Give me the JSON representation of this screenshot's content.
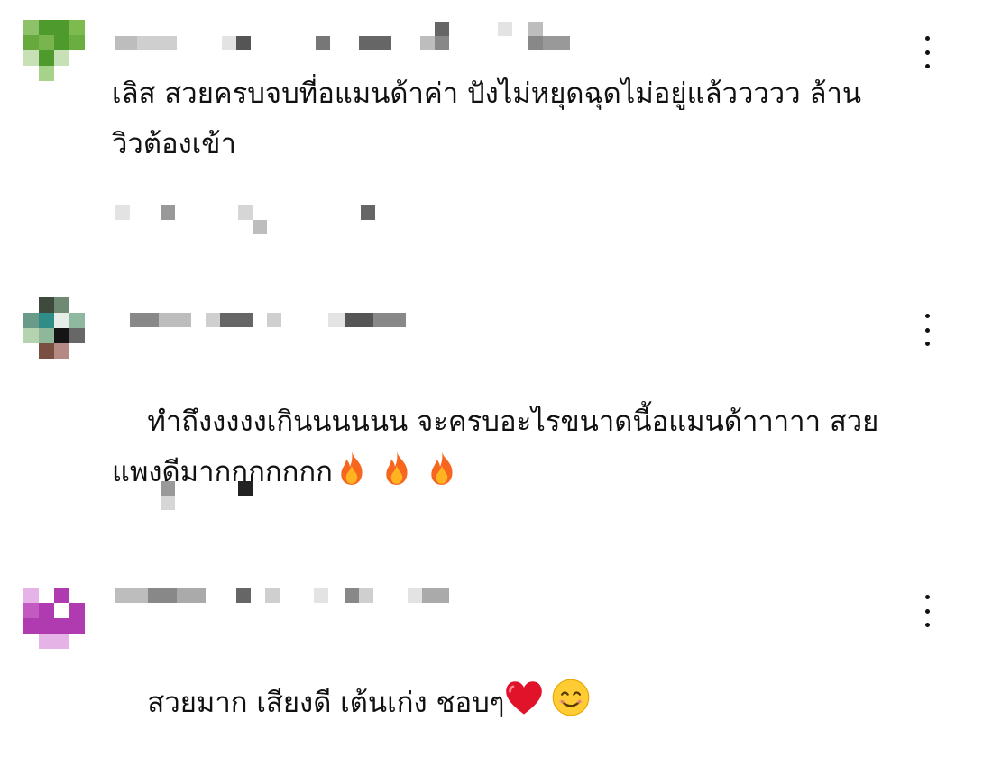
{
  "comments": [
    {
      "text": "เลิส สวยครบจบที่อแมนด้าค่า ปังไม่หยุดฉุดไม่อยู่แล้ววววว ล้าน\nวิวต้องเข้า",
      "avatar_colors": [
        "#8dc26a",
        "#4f9a2c",
        "#4f9a2c",
        "#7dbb4e",
        "#67a93d",
        "#79b54f",
        "#4f9a2c",
        "#6aad40",
        "#c7e0b6",
        "#4f9a2c",
        "#c7e0b6",
        "#ffffff",
        "#ffffff",
        "#a7d28a",
        "#ffffff",
        "#ffffff"
      ],
      "more_icon": "more-vert-icon"
    },
    {
      "text": "ทำถึงงงงงเกินนนนนน จะครบอะไรขนาดนี้อแมนด้าาาาา สวย\nแพงดีมากกกกกกก",
      "avatar_colors": [
        "#ffffff",
        "#3d4a3c",
        "#6f8a72",
        "#ffffff",
        "#6a9a88",
        "#2f8c86",
        "#e6ece8",
        "#8fb8a0",
        "#b5d3b0",
        "#8fb89a",
        "#151515",
        "#676767",
        "#ffffff",
        "#7a4e40",
        "#b58a84",
        "#ffffff"
      ],
      "more_icon": "more-vert-icon",
      "trailing_emoji": [
        "fire-icon",
        "fire-icon",
        "fire-icon"
      ]
    },
    {
      "text": "สวยมาก เสียงดี เต้นเก่ง ชอบๆ",
      "avatar_colors": [
        "#e6b3e6",
        "#ffffff",
        "#b03ab0",
        "#ffffff",
        "#c25ac2",
        "#b03ab0",
        "#ffffff",
        "#b03ab0",
        "#b03ab0",
        "#b03ab0",
        "#b03ab0",
        "#b03ab0",
        "#ffffff",
        "#e6b3e6",
        "#e6b3e6",
        "#ffffff"
      ],
      "more_icon": "more-vert-icon",
      "trailing_emoji": [
        "red-heart-icon",
        "smiling-face-icon"
      ]
    }
  ]
}
